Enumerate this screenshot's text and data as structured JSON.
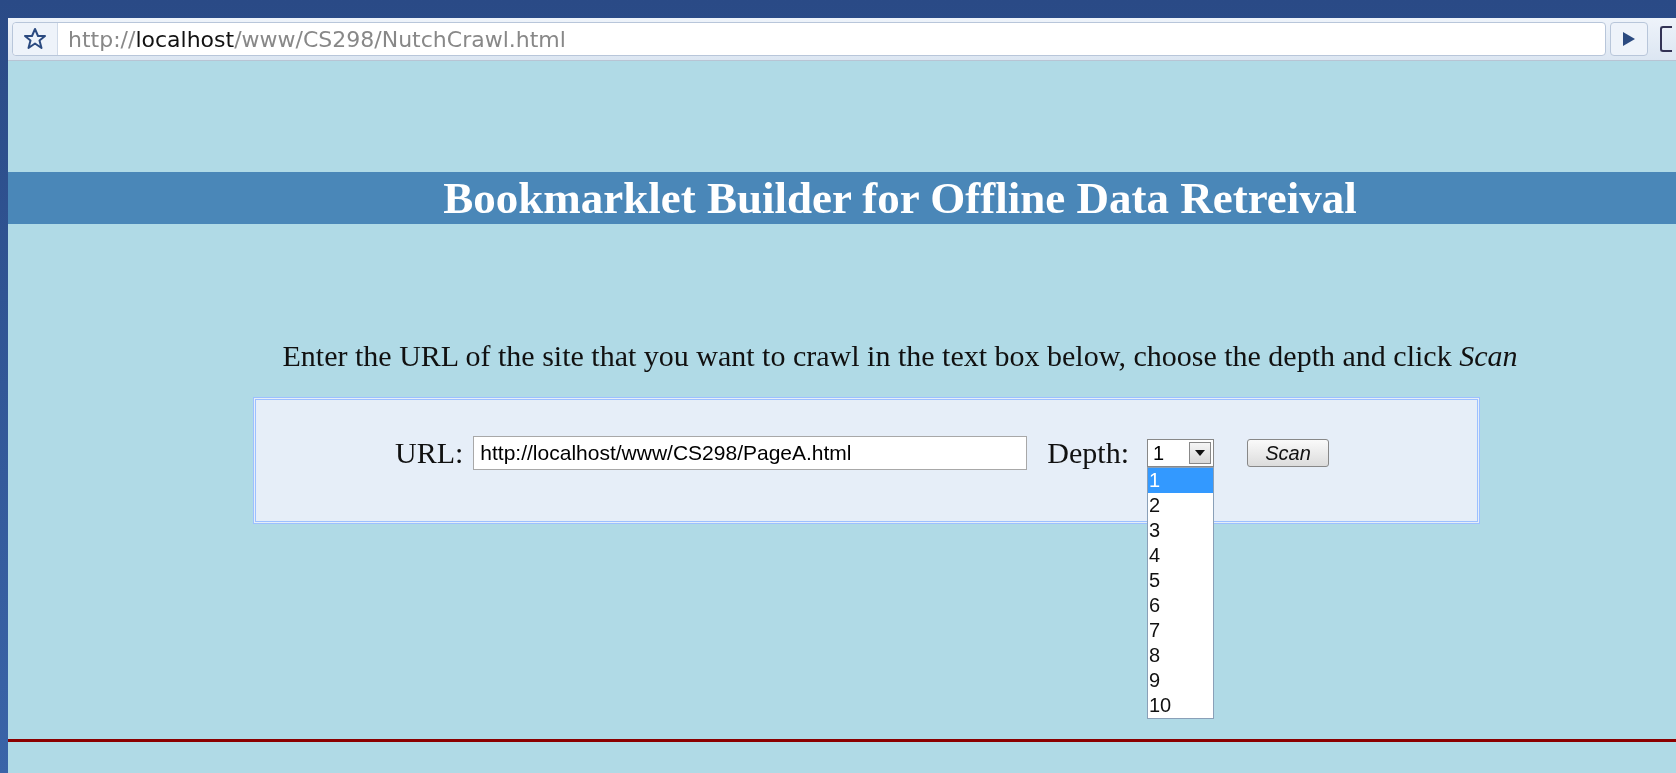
{
  "address_bar": {
    "scheme": "http://",
    "host": "localhost",
    "path": "/www/CS298/NutchCrawl.html"
  },
  "page": {
    "title": "Bookmarklet Builder for Offline Data Retreival",
    "instructions": "Enter the URL of the site that you want to crawl in the text box below, choose the depth and click *Scan*",
    "form": {
      "url_label": "URL:",
      "url_value": "http://localhost/www/CS298/PageA.html",
      "depth_label": "Depth:",
      "depth_value": "1",
      "depth_expanded": true,
      "depth_options": [
        {
          "label": "1",
          "selected": true
        },
        {
          "label": "2",
          "selected": false
        },
        {
          "label": "3",
          "selected": false
        },
        {
          "label": "4",
          "selected": false
        },
        {
          "label": "5",
          "selected": false
        },
        {
          "label": "6",
          "selected": false
        },
        {
          "label": "7",
          "selected": false
        },
        {
          "label": "8",
          "selected": false
        },
        {
          "label": "9",
          "selected": false
        },
        {
          "label": "10",
          "selected": false
        }
      ],
      "button": "Scan"
    }
  }
}
